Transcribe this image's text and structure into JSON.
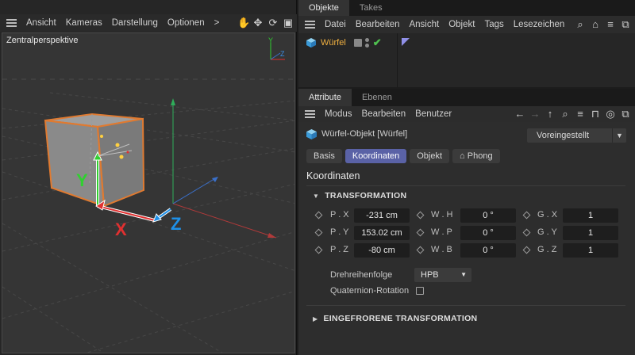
{
  "viewport": {
    "menu": [
      "Ansicht",
      "Kameras",
      "Darstellung",
      "Optionen",
      ">"
    ],
    "tool_icons": [
      "hand-icon",
      "move-icon",
      "rotate-icon",
      "maximize-icon"
    ],
    "camera_label": "Zentralperspektive",
    "axis_labels": {
      "x": "X",
      "y": "Y",
      "z": "Z"
    },
    "mini_axis_labels": {
      "y": "Y",
      "z": "Z"
    }
  },
  "objects_panel": {
    "tabs": [
      "Objekte",
      "Takes"
    ],
    "active_tab": "Objekte",
    "menu": [
      "Datei",
      "Bearbeiten",
      "Ansicht",
      "Objekt",
      "Tags",
      "Lesezeichen"
    ],
    "tool_icons": [
      "search-icon",
      "home-icon",
      "filter-icon",
      "new-window-icon"
    ],
    "object": {
      "name": "Würfel",
      "icon": "cube-icon",
      "enabled_mark": "✔"
    }
  },
  "attributes_panel": {
    "tabs": [
      "Attribute",
      "Ebenen"
    ],
    "active_tab": "Attribute",
    "menu": [
      "Modus",
      "Bearbeiten",
      "Benutzer"
    ],
    "tool_icons": [
      "arrow-left-icon",
      "arrow-right-icon",
      "arrow-up-icon",
      "search-icon",
      "filter-icon",
      "lock-icon",
      "target-icon",
      "new-window-icon"
    ],
    "object_title": "Würfel-Objekt [Würfel]",
    "preset": "Voreingestellt",
    "property_tabs": [
      "Basis",
      "Koordinaten",
      "Objekt",
      "Phong"
    ],
    "active_property_tab": "Koordinaten",
    "phong_glyph": "⌂",
    "section_title": "Koordinaten",
    "group_transformation": "TRANSFORMATION",
    "group_frozen": "EINGEFRORENE TRANSFORMATION",
    "coordinates": [
      {
        "p_label": "P . X",
        "p_value": "-231 cm",
        "w_label": "W . H",
        "w_value": "0 °",
        "g_label": "G . X",
        "g_value": "1"
      },
      {
        "p_label": "P . Y",
        "p_value": "153.02 cm",
        "w_label": "W . P",
        "w_value": "0 °",
        "g_label": "G . Y",
        "g_value": "1"
      },
      {
        "p_label": "P . Z",
        "p_value": "-80 cm",
        "w_label": "W . B",
        "w_value": "0 °",
        "g_label": "G . Z",
        "g_value": "1"
      }
    ],
    "rotation_order_label": "Drehreihenfolge",
    "rotation_order_value": "HPB",
    "quaternion_label": "Quaternion-Rotation",
    "quaternion_checked": false
  },
  "colors": {
    "accent": "#5a62a6",
    "axis_x": "#e03030",
    "axis_y": "#30d030",
    "axis_z": "#1e90e8",
    "object_name": "#f0b040",
    "selection_outline": "#e07a30"
  }
}
